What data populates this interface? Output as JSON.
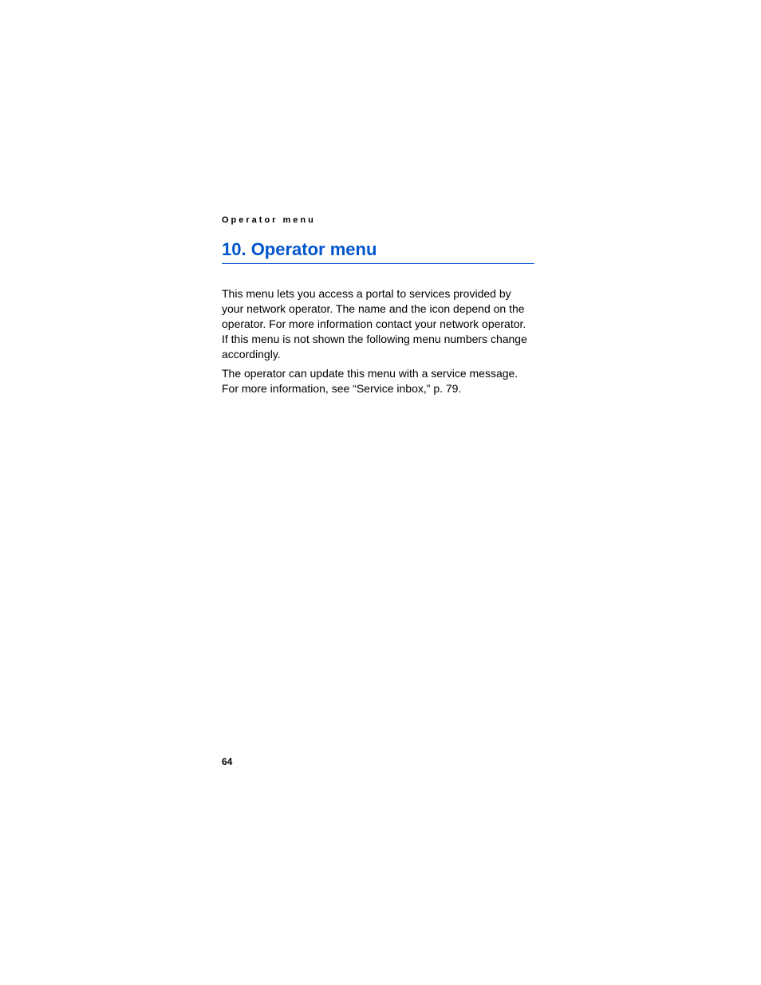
{
  "header": {
    "running_title": "Operator menu"
  },
  "chapter": {
    "title": "10. Operator menu"
  },
  "body": {
    "paragraph1": "This menu lets you access a portal to services provided by your network operator. The name and the icon depend on the operator. For more information contact your network operator. If this menu is not shown the following menu numbers change accordingly.",
    "paragraph2": "The operator can update this menu with a service message. For more information, see “Service inbox,” p. 79."
  },
  "footer": {
    "page_number": "64"
  }
}
